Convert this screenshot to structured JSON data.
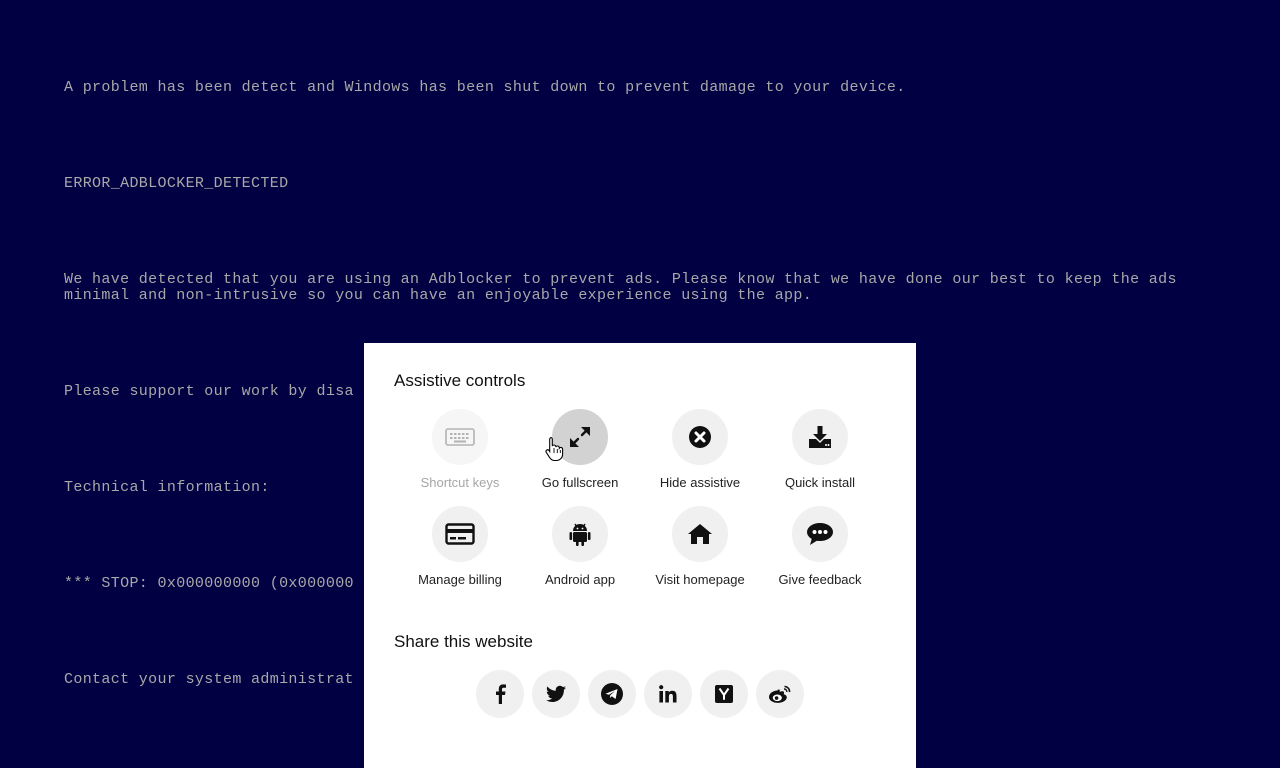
{
  "bsod": {
    "line1": "A problem has been detect and Windows has been shut down to prevent damage to your device.",
    "line2": "ERROR_ADBLOCKER_DETECTED",
    "line3a": "We have detected that you are using an Adblocker to prevent ads. Please know that we have done our best to keep the ads",
    "line3b": "minimal and non-intrusive so you can have an enjoyable experience using the app.",
    "line4": "Please support our work by disa",
    "line5": "Technical information:",
    "line6": "*** STOP: 0x000000000 (0x000000",
    "line7": "Contact your system administrat"
  },
  "assistive": {
    "title": "Assistive controls",
    "items": [
      {
        "label": "Shortcut keys",
        "icon": "keyboard-icon",
        "state": "disabled"
      },
      {
        "label": "Go fullscreen",
        "icon": "expand-icon",
        "state": "hover"
      },
      {
        "label": "Hide assistive",
        "icon": "close-circle-icon"
      },
      {
        "label": "Quick install",
        "icon": "download-icon"
      },
      {
        "label": "Manage billing",
        "icon": "credit-card-icon"
      },
      {
        "label": "Android app",
        "icon": "android-icon"
      },
      {
        "label": "Visit homepage",
        "icon": "home-icon"
      },
      {
        "label": "Give feedback",
        "icon": "chat-bubble-icon"
      }
    ]
  },
  "share": {
    "title": "Share this website",
    "items": [
      {
        "icon": "facebook-icon"
      },
      {
        "icon": "twitter-icon"
      },
      {
        "icon": "telegram-icon"
      },
      {
        "icon": "linkedin-icon"
      },
      {
        "icon": "hacker-news-icon"
      },
      {
        "icon": "weibo-icon"
      }
    ]
  },
  "colors": {
    "background": "#000042",
    "bsod_text": "#a8a8a8",
    "panel": "#ffffff",
    "icon_circle": "#f0f0f0"
  }
}
